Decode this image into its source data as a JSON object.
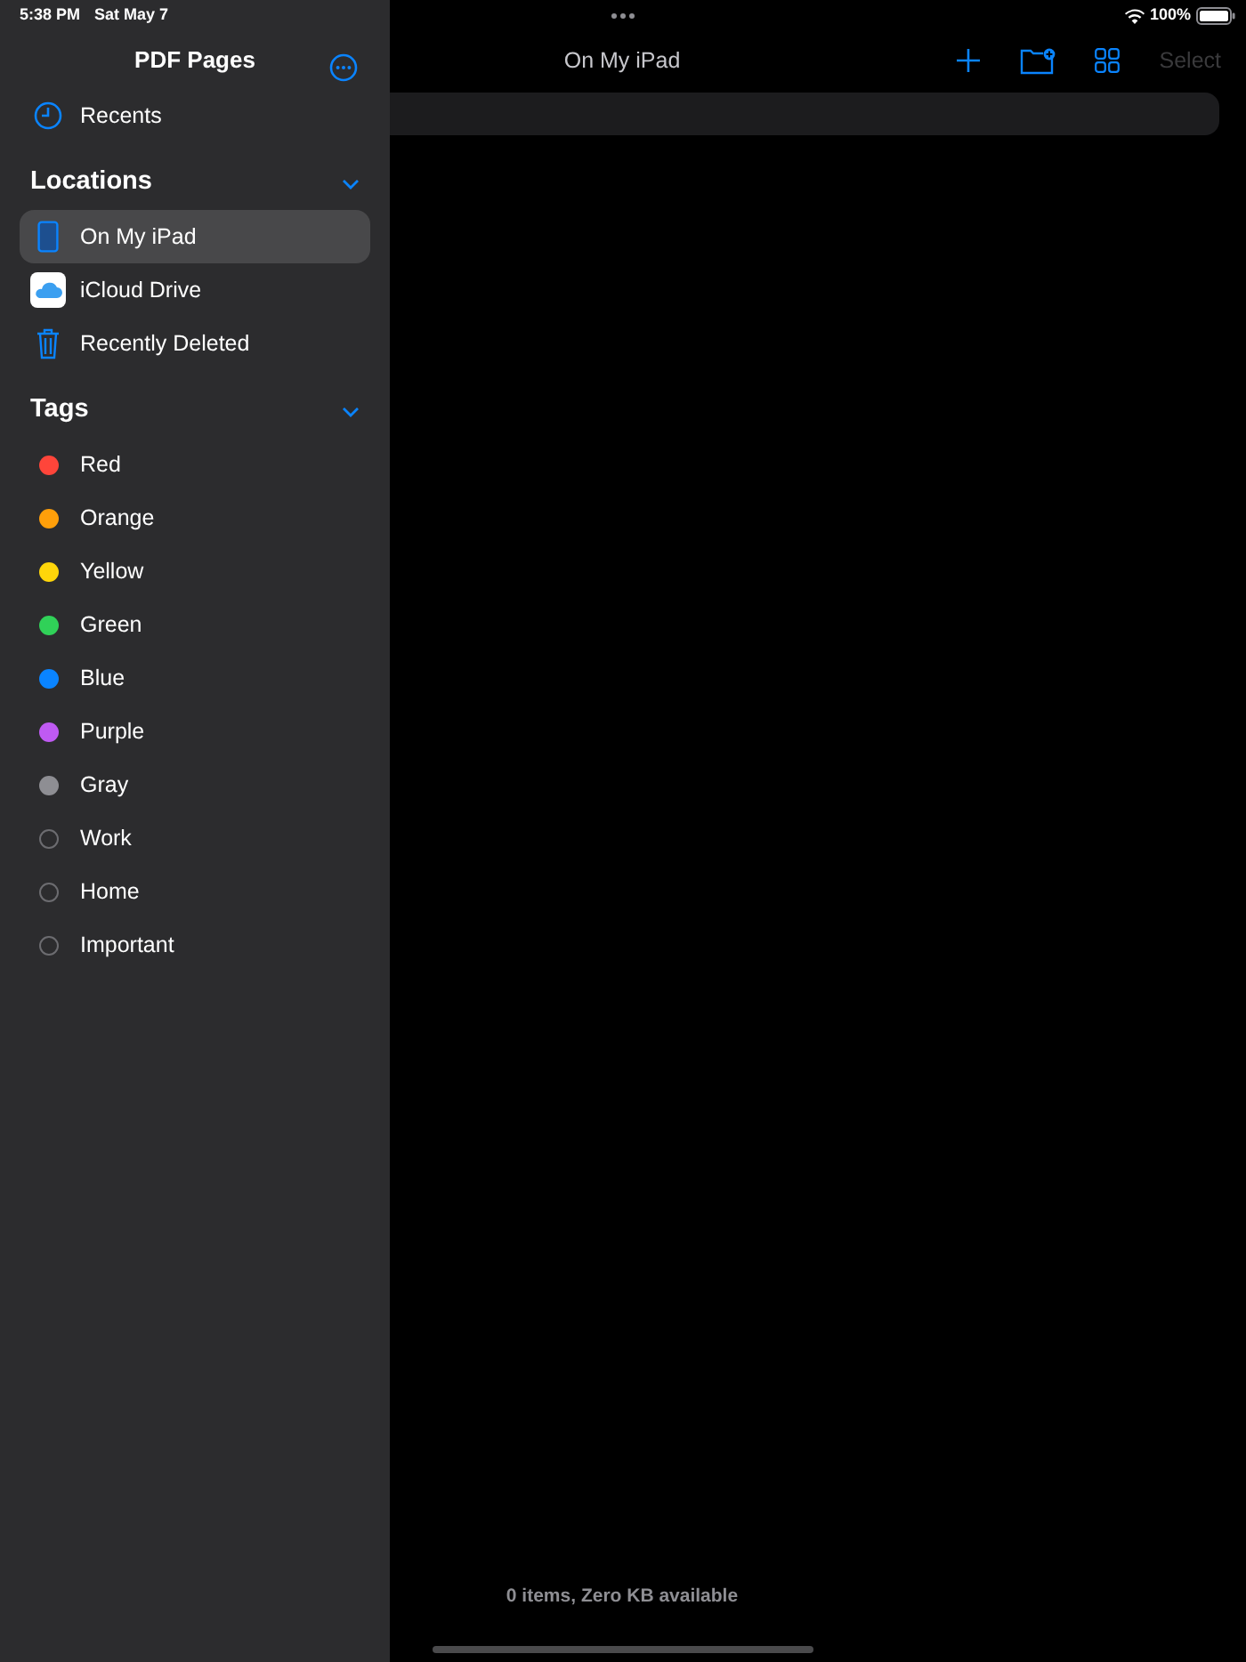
{
  "status_bar": {
    "time": "5:38 PM",
    "date": "Sat May 7",
    "battery": "100%"
  },
  "sidebar": {
    "title": "PDF Pages",
    "recents": {
      "label": "Recents"
    },
    "locations": {
      "heading": "Locations",
      "expanded": true,
      "items": [
        {
          "label": "On My iPad",
          "kind": "ipad",
          "selected": true
        },
        {
          "label": "iCloud Drive",
          "kind": "icloud",
          "selected": false
        },
        {
          "label": "Recently Deleted",
          "kind": "trash",
          "selected": false
        }
      ]
    },
    "tags": {
      "heading": "Tags",
      "expanded": true,
      "items": [
        {
          "label": "Red",
          "kind": "filled",
          "color": "#ff453a"
        },
        {
          "label": "Orange",
          "kind": "filled",
          "color": "#ff9f0a"
        },
        {
          "label": "Yellow",
          "kind": "filled",
          "color": "#ffd60a"
        },
        {
          "label": "Green",
          "kind": "filled",
          "color": "#30d158"
        },
        {
          "label": "Blue",
          "kind": "filled",
          "color": "#0a84ff"
        },
        {
          "label": "Purple",
          "kind": "filled",
          "color": "#bf5af2"
        },
        {
          "label": "Gray",
          "kind": "filled",
          "color": "#8e8e93"
        },
        {
          "label": "Work",
          "kind": "outline"
        },
        {
          "label": "Home",
          "kind": "outline"
        },
        {
          "label": "Important",
          "kind": "outline"
        }
      ]
    }
  },
  "main": {
    "title": "On My iPad",
    "select": {
      "label": "Select",
      "disabled": true
    },
    "footer": "0 items, Zero KB available"
  }
}
